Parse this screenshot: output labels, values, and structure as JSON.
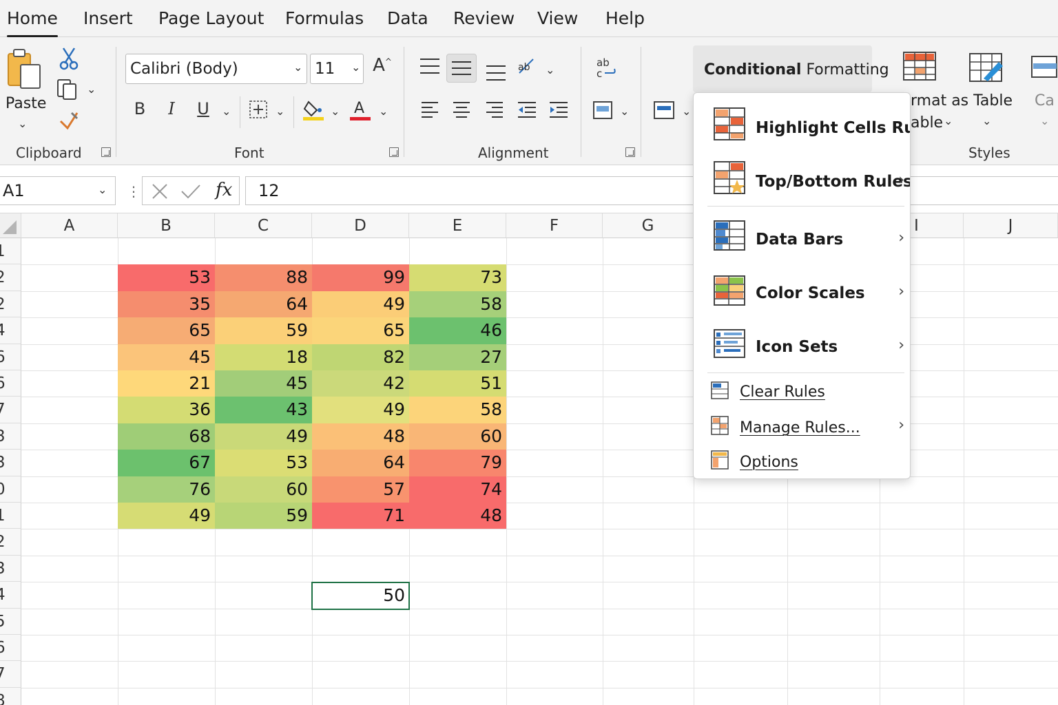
{
  "tabs": [
    "Home",
    "Insert",
    "Page Layout",
    "Formulas",
    "Data",
    "Review",
    "View",
    "Help"
  ],
  "ribbon": {
    "clipboard": {
      "paste_label": "Paste",
      "group_label": "Clipboard"
    },
    "font": {
      "family": "Calibri (Body)",
      "size": "11",
      "group_label": "Font"
    },
    "alignment": {
      "group_label": "Alignment"
    },
    "conditional_formatting_label_bold": "Conditional",
    "conditional_formatting_label": "Formatting",
    "format_as_table": {
      "line1": "rmat  as  Table",
      "line2": "able"
    },
    "styles_label": "Styles",
    "cell_styles_partial": "Ca"
  },
  "formula_bar": {
    "name_box": "A1",
    "fx": "fx",
    "formula": "12"
  },
  "columns": [
    "A",
    "B",
    "C",
    "D",
    "E",
    "F",
    "G",
    "I",
    "J"
  ],
  "row_numbers": [
    "1",
    "2",
    "2",
    "4",
    "6",
    "6",
    "7",
    "3",
    "3",
    "0",
    "1",
    "2",
    "3",
    "4",
    "5",
    "6",
    "7",
    "8"
  ],
  "table": {
    "rows": [
      [
        53,
        88,
        99,
        73
      ],
      [
        35,
        64,
        49,
        58
      ],
      [
        65,
        59,
        65,
        46
      ],
      [
        45,
        18,
        82,
        27
      ],
      [
        21,
        45,
        42,
        51
      ],
      [
        36,
        43,
        49,
        58
      ],
      [
        68,
        49,
        48,
        60
      ],
      [
        67,
        53,
        64,
        79
      ],
      [
        76,
        60,
        57,
        74
      ],
      [
        49,
        59,
        71,
        48
      ]
    ],
    "colors": [
      [
        "#f86b6b",
        "#f58e6e",
        "#f5796c",
        "#d6dc72"
      ],
      [
        "#f58d6e",
        "#f5a871",
        "#fbcd77",
        "#a6d07a"
      ],
      [
        "#f6ac74",
        "#fbd078",
        "#fbd57a",
        "#6cc16e"
      ],
      [
        "#fbc47a",
        "#d3dc73",
        "#bfd673",
        "#a5cf79"
      ],
      [
        "#fed87a",
        "#a2cd79",
        "#cbd97a",
        "#d5dc72"
      ],
      [
        "#d4dc73",
        "#6cc16f",
        "#e2e07d",
        "#fcd47a"
      ],
      [
        "#9fcd77",
        "#cad978",
        "#fbc077",
        "#f9b676"
      ],
      [
        "#6cc16d",
        "#dbdd74",
        "#f8ad72",
        "#f8866d"
      ],
      [
        "#a6d07b",
        "#c8d979",
        "#f8936e",
        "#f86b6b"
      ],
      [
        "#d6dc74",
        "#b8d576",
        "#f86b6b",
        "#f86b6b"
      ]
    ]
  },
  "selected_cell_value": "50",
  "cf_menu": {
    "items": [
      {
        "label": "Highlight Cells Rules",
        "arrow": ""
      },
      {
        "label": "Top/Bottom Rules",
        "arrow": "›"
      },
      {
        "label": "Data Bars",
        "arrow": "›"
      },
      {
        "label": "Color Scales",
        "arrow": "›"
      },
      {
        "label": "Icon Sets",
        "arrow": "›"
      }
    ],
    "small_items": [
      {
        "label": "Clear Rules",
        "arrow": ""
      },
      {
        "label": "Manage Rules...",
        "arrow": "›"
      },
      {
        "label": "Options",
        "arrow": ""
      }
    ]
  }
}
